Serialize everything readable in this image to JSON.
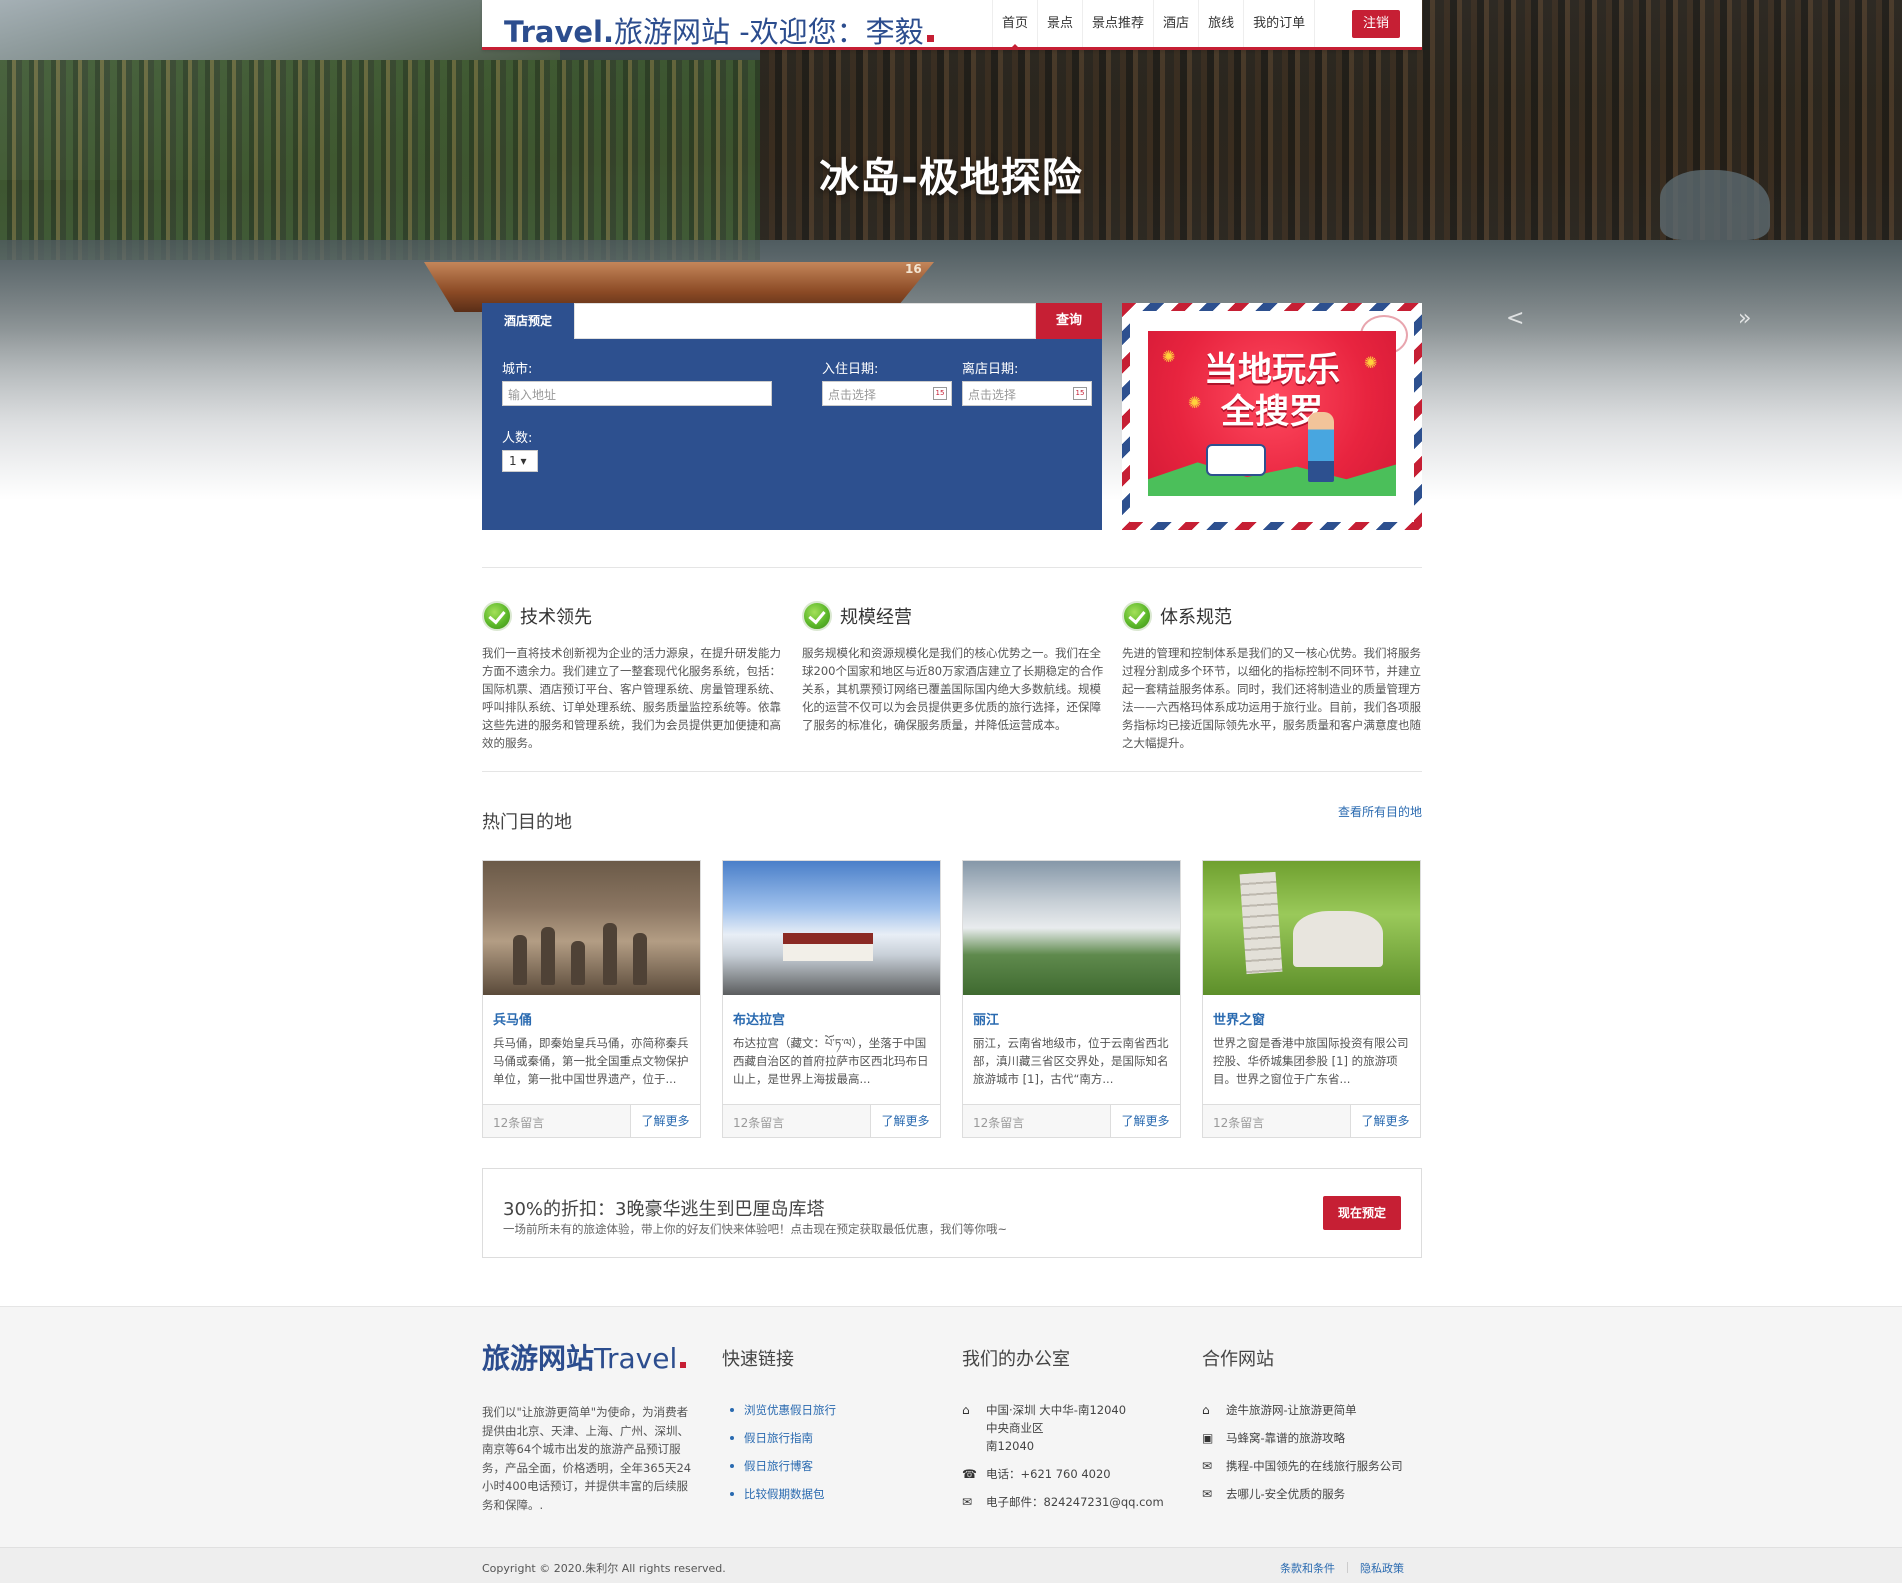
{
  "navbar": {
    "brand_prefix": "Travel.",
    "brand_text": "旅游网站 -欢迎您：李毅",
    "items": [
      {
        "label": "首页",
        "active": true
      },
      {
        "label": "景点"
      },
      {
        "label": "景点推荐"
      },
      {
        "label": "酒店"
      },
      {
        "label": "旅线"
      },
      {
        "label": "我的订单"
      }
    ],
    "logout_label": "注销",
    "accent_color": "#c61f34",
    "brand_color": "#2c4d8e"
  },
  "hero": {
    "title": "冰岛-极地探险",
    "boat_number": "16",
    "prev_arrow": "<",
    "next_arrow": "»"
  },
  "booking": {
    "tab_label": "酒店预定",
    "search_value": "",
    "search_button": "查询",
    "city_label": "城市:",
    "city_placeholder": "输入地址",
    "checkin_label": "入住日期:",
    "checkin_placeholder": "点击选择",
    "checkout_label": "离店日期:",
    "checkout_placeholder": "点击选择",
    "guests_label": "人数:",
    "guests_value": "1"
  },
  "promo": {
    "text_line1": "当地玩乐",
    "text_line2": "全搜罗"
  },
  "features": [
    {
      "title": "技术领先",
      "text": "我们一直将技术创新视为企业的活力源泉，在提升研发能力方面不遗余力。我们建立了一整套现代化服务系统，包括：国际机票、酒店预订平台、客户管理系统、房量管理系统、呼叫排队系统、订单处理系统、服务质量监控系统等。依靠这些先进的服务和管理系统，我们为会员提供更加便捷和高效的服务。"
    },
    {
      "title": "规模经营",
      "text": "服务规模化和资源规模化是我们的核心优势之一。我们在全球200个国家和地区与近80万家酒店建立了长期稳定的合作关系，其机票预订网络已覆盖国际国内绝大多数航线。规模化的运营不仅可以为会员提供更多优质的旅行选择，还保障了服务的标准化，确保服务质量，并降低运营成本。"
    },
    {
      "title": "体系规范",
      "text": "先进的管理和控制体系是我们的又一核心优势。我们将服务过程分割成多个环节，以细化的指标控制不同环节，并建立起一套精益服务体系。同时，我们还将制造业的质量管理方法——六西格玛体系成功运用于旅行业。目前，我们各项服务指标均已接近国际领先水平，服务质量和客户满意度也随之大幅提升。"
    }
  ],
  "destinations": {
    "title": "热门目的地",
    "view_all": "查看所有目的地",
    "items": [
      {
        "name": "兵马俑",
        "desc": "兵马俑，即秦始皇兵马俑，亦简称秦兵马俑或秦俑，第一批全国重点文物保护单位，第一批中国世界遗产，位于...",
        "comments": "12条留言",
        "more": "了解更多"
      },
      {
        "name": "布达拉宫",
        "desc": "布达拉宫（藏文：པོ་ཏ་ལ），坐落于中国西藏自治区的首府拉萨市区西北玛布日山上，是世界上海拔最高...",
        "comments": "12条留言",
        "more": "了解更多"
      },
      {
        "name": "丽江",
        "desc": "丽江，云南省地级市，位于云南省西北部，滇川藏三省区交界处，是国际知名旅游城市 [1]，古代“南方...",
        "comments": "12条留言",
        "more": "了解更多"
      },
      {
        "name": "世界之窗",
        "desc": "世界之窗是香港中旅国际投资有限公司控股、华侨城集团参股 [1] 的旅游项目。世界之窗位于广东省...",
        "comments": "12条留言",
        "more": "了解更多"
      }
    ]
  },
  "deal": {
    "title": "30%的折扣：3晚豪华逃生到巴厘岛库塔",
    "subtitle": "一场前所未有的旅途体验，带上你的好友们快来体验吧！点击现在预定获取最低优惠，我们等你哦~",
    "button": "现在预定"
  },
  "footer": {
    "logo_bold": "旅游网站",
    "logo_light": "Travel",
    "about": "我们以\"让旅游更简单\"为使命，为消费者提供由北京、天津、上海、广州、深圳、南京等64个城市出发的旅游产品预订服务，产品全面，价格透明，全年365天24小时400电话预订，并提供丰富的后续服务和保障。.",
    "quick_title": "快速链接",
    "quick_links": [
      "浏览优惠假日旅行",
      "假日旅行指南",
      "假日旅行博客",
      "比较假期数据包"
    ],
    "office_title": "我们的办公室",
    "office_address": [
      "中国·深圳 大中华-南12040",
      "中央商业区",
      "南12040"
    ],
    "office_phone": "电话：+621 760 4020",
    "office_email": "电子邮件：824247231@qq.com",
    "partner_title": "合作网站",
    "partners": [
      "途牛旅游网-让旅游更简单",
      "马蜂窝-靠谱的旅游攻略",
      "携程-中国领先的在线旅行服务公司",
      "去哪儿-安全优质的服务"
    ],
    "copyright": "Copyright © 2020.朱利尔 All rights reserved.",
    "terms": "条款和条件",
    "privacy": "隐私政策"
  }
}
